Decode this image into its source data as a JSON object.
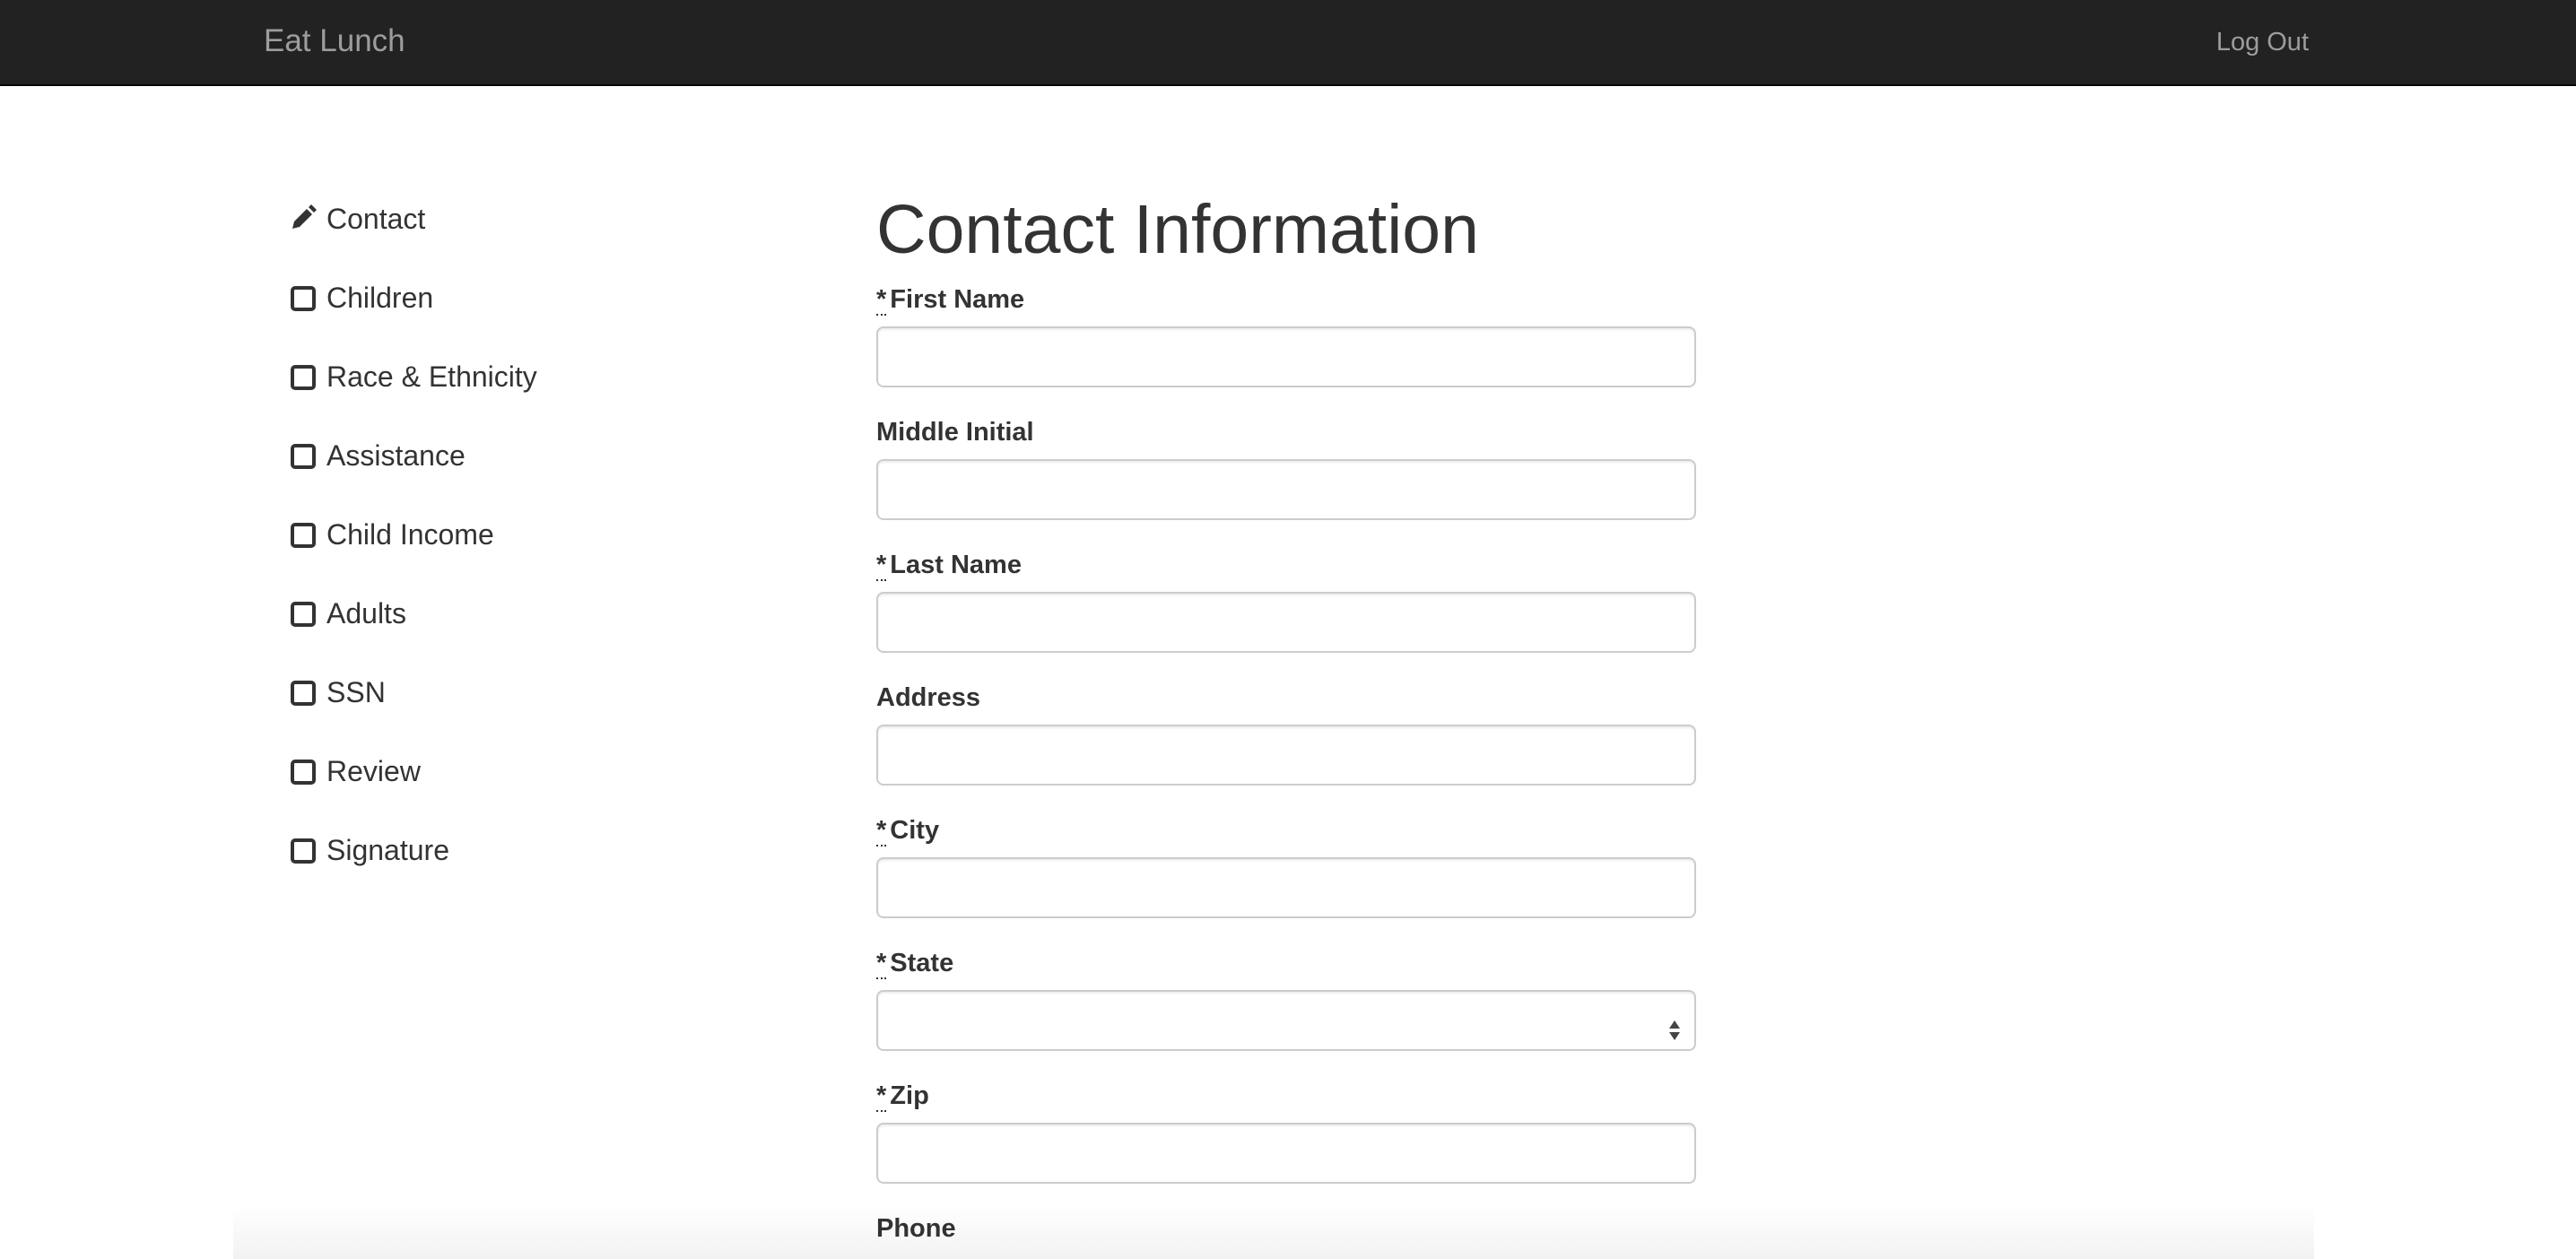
{
  "navbar": {
    "brand": "Eat Lunch",
    "logout_label": "Log Out",
    "background_color": "#222222",
    "link_color": "#9d9d9d"
  },
  "sidebar": {
    "items": [
      {
        "label": "Contact",
        "icon": "pencil-icon",
        "status": "current"
      },
      {
        "label": "Children",
        "icon": "empty-checkbox-icon",
        "status": "incomplete"
      },
      {
        "label": "Race & Ethnicity",
        "icon": "empty-checkbox-icon",
        "status": "incomplete"
      },
      {
        "label": "Assistance",
        "icon": "empty-checkbox-icon",
        "status": "incomplete"
      },
      {
        "label": "Child Income",
        "icon": "empty-checkbox-icon",
        "status": "incomplete"
      },
      {
        "label": "Adults",
        "icon": "empty-checkbox-icon",
        "status": "incomplete"
      },
      {
        "label": "SSN",
        "icon": "empty-checkbox-icon",
        "status": "incomplete"
      },
      {
        "label": "Review",
        "icon": "empty-checkbox-icon",
        "status": "incomplete"
      },
      {
        "label": "Signature",
        "icon": "empty-checkbox-icon",
        "status": "incomplete"
      }
    ]
  },
  "main": {
    "title": "Contact Information",
    "required_marker": "*",
    "fields": {
      "first_name": {
        "label": "First Name",
        "required": true,
        "value": "",
        "placeholder": ""
      },
      "middle_initial": {
        "label": "Middle Initial",
        "required": false,
        "value": "",
        "placeholder": ""
      },
      "last_name": {
        "label": "Last Name",
        "required": true,
        "value": "",
        "placeholder": ""
      },
      "address": {
        "label": "Address",
        "required": false,
        "value": "",
        "placeholder": ""
      },
      "city": {
        "label": "City",
        "required": true,
        "value": "",
        "placeholder": ""
      },
      "state": {
        "label": "State",
        "required": true,
        "selected": ""
      },
      "zip": {
        "label": "Zip",
        "required": true,
        "value": "",
        "placeholder": ""
      },
      "phone": {
        "label": "Phone",
        "required": false
      }
    }
  }
}
